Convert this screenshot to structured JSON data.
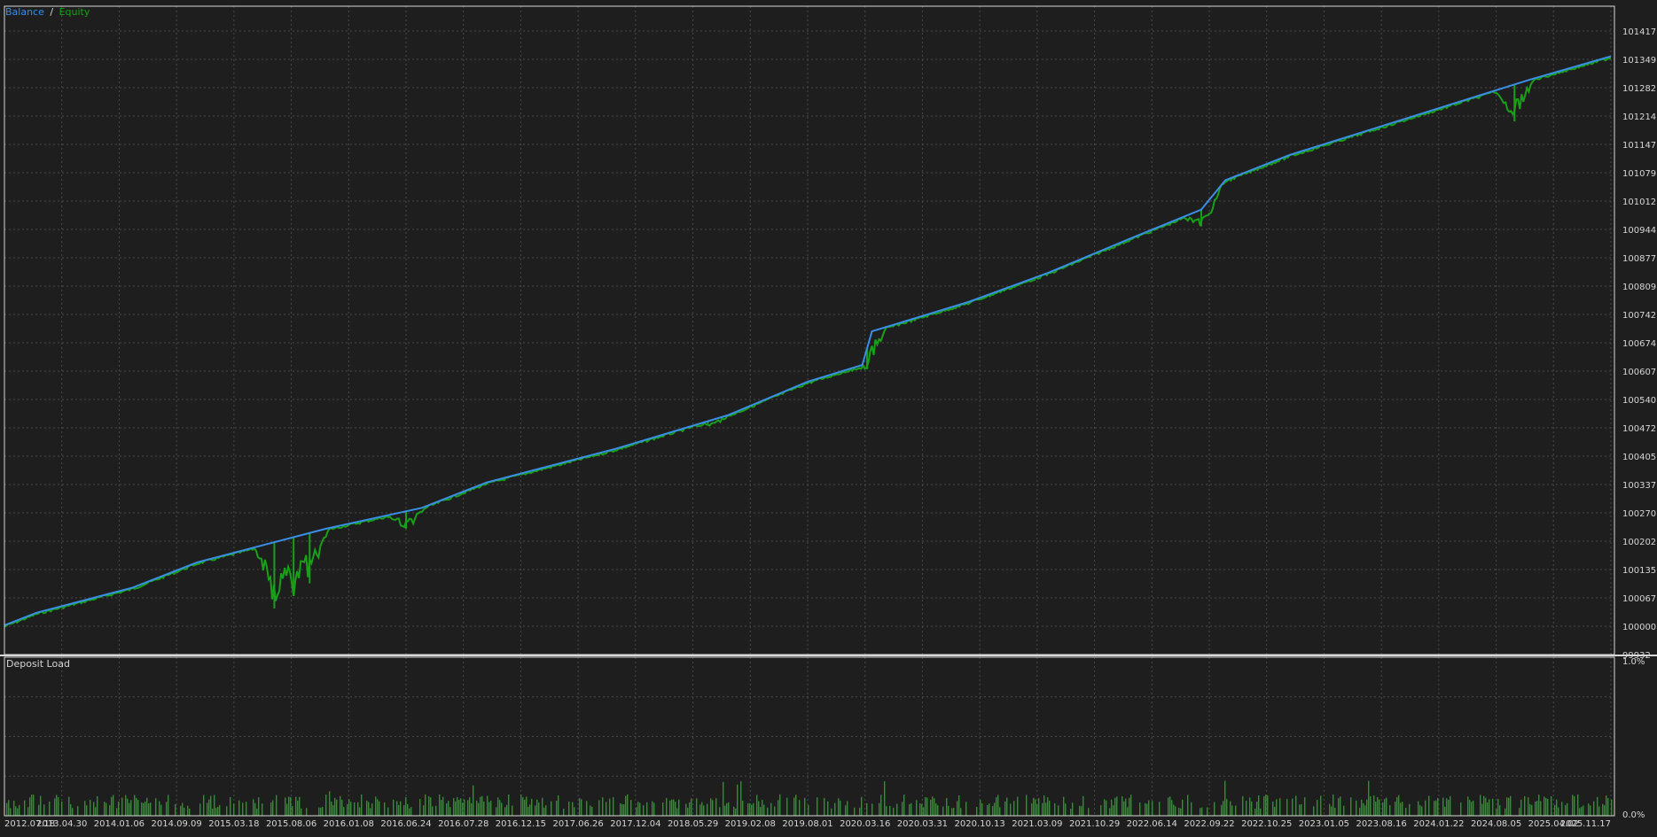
{
  "top_panel": {
    "legend": {
      "balance": "Balance",
      "separator": "/",
      "equity": "Equity"
    },
    "yticks": [
      "101417",
      "101349",
      "101282",
      "101214",
      "101147",
      "101079",
      "101012",
      "100944",
      "100877",
      "100809",
      "100742",
      "100674",
      "100607",
      "100540",
      "100472",
      "100405",
      "100337",
      "100270",
      "100202",
      "100135",
      "100067",
      "100000",
      "99932"
    ]
  },
  "bottom_panel": {
    "title": "Deposit Load",
    "yticks": [
      "1.0%",
      "0.0%"
    ]
  },
  "xticks": [
    "2012.07.18",
    "2013.04.30",
    "2014.01.06",
    "2014.09.09",
    "2015.03.18",
    "2015.08.06",
    "2016.01.08",
    "2016.06.24",
    "2016.07.28",
    "2016.12.15",
    "2017.06.26",
    "2017.12.04",
    "2018.05.29",
    "2019.02.08",
    "2019.08.01",
    "2020.03.16",
    "2020.03.31",
    "2020.10.13",
    "2021.03.09",
    "2021.10.29",
    "2022.06.14",
    "2022.09.22",
    "2022.10.25",
    "2023.01.05",
    "2023.08.16",
    "2024.01.22",
    "2024.08.05",
    "2025.04.02",
    "2025.11.17"
  ],
  "colors": {
    "background": "#1e1e1e",
    "grid": "#4a4a4a",
    "frame": "#d8d8d8",
    "balance": "#3a8ee6",
    "equity": "#19a019",
    "text": "#d6d6d6"
  },
  "chart_data": [
    {
      "type": "line",
      "ylim": [
        99932,
        101417
      ],
      "grid": true,
      "legend": "top-left",
      "x": [
        0,
        0.02,
        0.05,
        0.08,
        0.12,
        0.15,
        0.2,
        0.26,
        0.3,
        0.38,
        0.45,
        0.5,
        0.534,
        0.54,
        0.6,
        0.65,
        0.7,
        0.745,
        0.76,
        0.8,
        0.85,
        0.9,
        0.95,
        1.0
      ],
      "series": [
        {
          "name": "Balance",
          "y": [
            100000,
            100030,
            100060,
            100090,
            100150,
            100180,
            100230,
            100280,
            100340,
            100420,
            100500,
            100580,
            100620,
            100700,
            100770,
            100840,
            100920,
            100990,
            101060,
            101120,
            101180,
            101240,
            101300,
            101355
          ]
        },
        {
          "name": "Equity",
          "y": [
            100000,
            100030,
            100060,
            100090,
            100150,
            100180,
            100230,
            100280,
            100340,
            100420,
            100500,
            100580,
            100620,
            100700,
            100770,
            100840,
            100920,
            100990,
            101060,
            101120,
            101180,
            101240,
            101300,
            101355
          ],
          "drawdowns": [
            {
              "at": 0.168,
              "min": 100040
            },
            {
              "at": 0.18,
              "min": 100070
            },
            {
              "at": 0.19,
              "min": 100100
            },
            {
              "at": 0.25,
              "min": 100230
            },
            {
              "at": 0.438,
              "min": 100480
            },
            {
              "at": 0.537,
              "min": 100610
            },
            {
              "at": 0.745,
              "min": 100950
            },
            {
              "at": 0.94,
              "min": 101200
            }
          ]
        }
      ]
    },
    {
      "type": "bar",
      "title": "Deposit Load",
      "ylim": [
        0,
        1.0
      ],
      "values_note_none": "",
      "typical_value": 0.09,
      "max_value": 0.22
    }
  ]
}
